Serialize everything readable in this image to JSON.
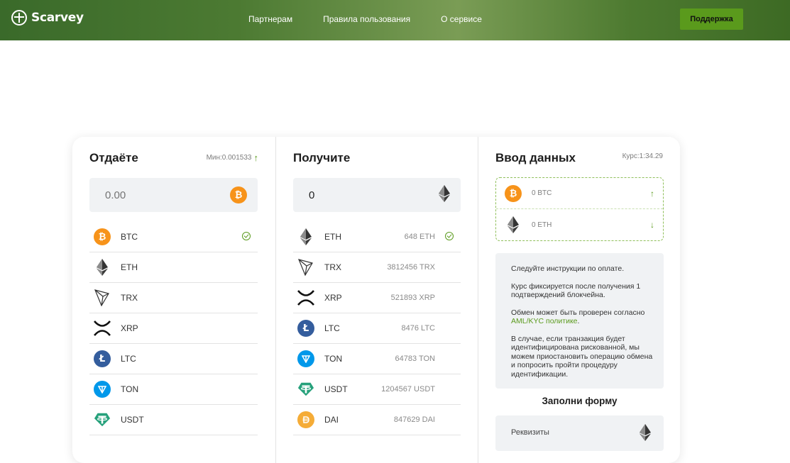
{
  "header": {
    "brand": "Scarvey",
    "nav": [
      "Партнерам",
      "Правила пользования",
      "О сервисе"
    ],
    "support_label": "Поддержка"
  },
  "give": {
    "title": "Отдаёте",
    "min_label": "Мин:0.001533",
    "amount_placeholder": "0.00",
    "selected": "BTC",
    "items": [
      {
        "code": "BTC",
        "icon": "btc-icon"
      },
      {
        "code": "ETH",
        "icon": "eth-icon"
      },
      {
        "code": "TRX",
        "icon": "trx-icon"
      },
      {
        "code": "XRP",
        "icon": "xrp-icon"
      },
      {
        "code": "LTC",
        "icon": "ltc-icon"
      },
      {
        "code": "TON",
        "icon": "ton-icon"
      },
      {
        "code": "USDT",
        "icon": "usdt-icon"
      }
    ]
  },
  "receive": {
    "title": "Получите",
    "amount_value": "0",
    "selected": "ETH",
    "items": [
      {
        "code": "ETH",
        "reserve": "648 ETH",
        "icon": "eth-icon"
      },
      {
        "code": "TRX",
        "reserve": "3812456 TRX",
        "icon": "trx-icon"
      },
      {
        "code": "XRP",
        "reserve": "521893 XRP",
        "icon": "xrp-icon"
      },
      {
        "code": "LTC",
        "reserve": "8476 LTC",
        "icon": "ltc-icon"
      },
      {
        "code": "TON",
        "reserve": "64783 TON",
        "icon": "ton-icon"
      },
      {
        "code": "USDT",
        "reserve": "1204567 USDT",
        "icon": "usdt-icon"
      },
      {
        "code": "DAI",
        "reserve": "847629 DAI",
        "icon": "dai-icon"
      }
    ]
  },
  "details": {
    "title": "Ввод данных",
    "rate_label": "Курс:1:34.29",
    "send_summary": "0 BTC",
    "receive_summary": "0 ETH",
    "info": {
      "p1": "Следуйте инструкции по оплате.",
      "p2": "Курс фиксируется после получения 1 подтверждений блокчейна.",
      "p3_before": "Обмен может быть проверен согласно ",
      "p3_link": "AML/KYC политике",
      "p3_after": ".",
      "p4": "В случае, если транзакция будет идентифицирована рискованной, мы можем приостановить операцию обмена и попросить пройти процедуру идентификации."
    },
    "form_title": "Заполни форму",
    "requisites_label": "Реквизиты"
  },
  "colors": {
    "accent": "#5a9a1c",
    "btc": "#f7931a",
    "ltc": "#345d9d",
    "ton": "#0098ea",
    "usdt": "#26a17b",
    "dai": "#f5ac37"
  }
}
